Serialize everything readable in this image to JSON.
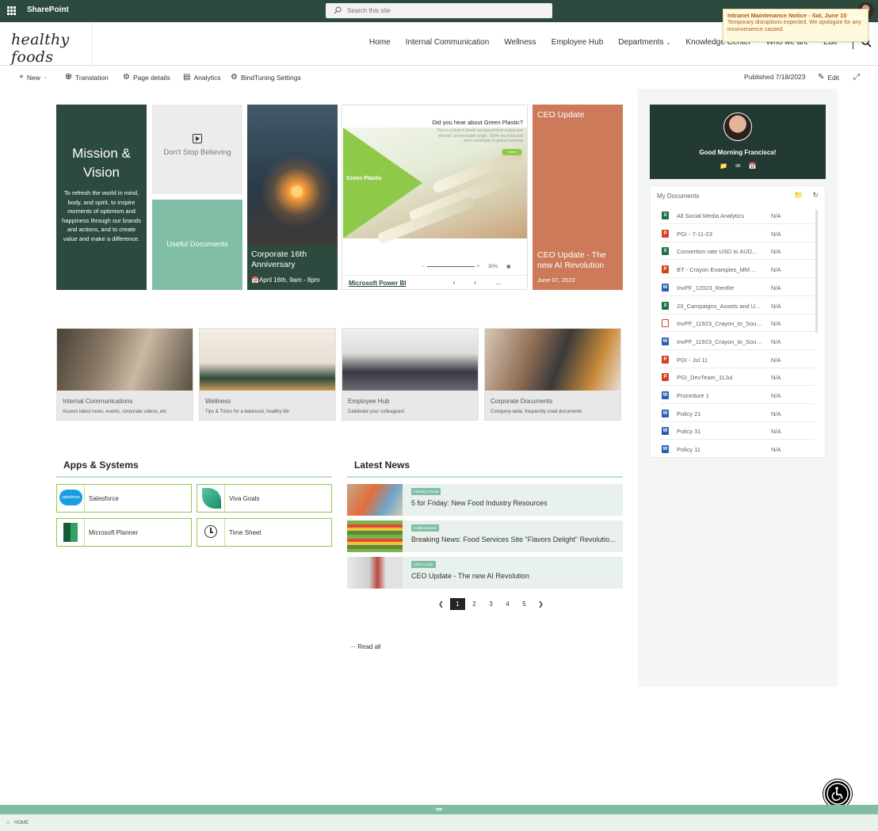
{
  "suite": {
    "app_name": "SharePoint",
    "search_placeholder": "Search this site"
  },
  "site": {
    "logo": "healthy foods",
    "nav": [
      {
        "label": "Home"
      },
      {
        "label": "Internal Communication"
      },
      {
        "label": "Wellness"
      },
      {
        "label": "Employee Hub"
      },
      {
        "label": "Departments",
        "has_menu": true
      },
      {
        "label": "Knowledge Center"
      },
      {
        "label": "Who we are"
      },
      {
        "label": "Edit"
      }
    ]
  },
  "notice": {
    "title": "Intranet Maintenance Notice - Sat, June 10",
    "body": "Temporary disruptions expected. We apologize for any inconvenience caused."
  },
  "commandbar": {
    "new": "New",
    "translation": "Translation",
    "page_details": "Page details",
    "analytics": "Analytics",
    "bindtuning": "BindTuning Settings",
    "published": "Published 7/18/2023",
    "edit": "Edit"
  },
  "hero": {
    "mission_title": "Mission & Vision",
    "mission_text": "To refresh the world in mind, body, and spirit, to inspire moments of optimism and happiness through our brands and actions, and to create value and make a difference.",
    "dont_stop": "Don't Stop Believing",
    "useful_docs": "Useful Documents",
    "anniversary_title": "Corporate 16th Anniversary",
    "anniversary_date": "April 16th, 9am - 8pm",
    "pbi_question": "Did you hear about Green Plastic?",
    "pbi_sub": "This is a kind of plastic produced from sugarcane ethanol, of renewable origin. 100% recycled and don't contribute to global warming",
    "pbi_green_label": "Green Plastic",
    "pbi_btn": "more",
    "pbi_zoom": "30%",
    "pbi_link": "Microsoft Power BI",
    "ceo_top": "CEO Update",
    "ceo_title": "CEO Update - The new AI Revolution",
    "ceo_date": "June 07, 2023"
  },
  "cards": [
    {
      "title": "Internal Communications",
      "desc": "Access latest news, events, corporate videos, etc"
    },
    {
      "title": "Wellness",
      "desc": "Tips & Tricks for a balanced, healthy life"
    },
    {
      "title": "Employee Hub",
      "desc": "Celebrate your colleagues!"
    },
    {
      "title": "Corporate Documents",
      "desc": "Company-wide, frequently used documents"
    }
  ],
  "apps": {
    "title": "Apps & Systems",
    "items": [
      {
        "label": "Salesforce",
        "icon_text": "salesforce"
      },
      {
        "label": "Viva Goals"
      },
      {
        "label": "Microsoft Planner"
      },
      {
        "label": "Time Sheet"
      }
    ]
  },
  "news": {
    "title": "Latest News",
    "items": [
      {
        "tag": "Industry Trends",
        "title": "5 for Friday: New Food Industry Resources"
      },
      {
        "tag": "Collaborations",
        "title": "Breaking News: Food Services Site \"Flavors Delight\" Revolutio..."
      },
      {
        "tag": "CEO Corner",
        "title": "CEO Update - The new AI Revolution"
      }
    ],
    "pages": [
      "1",
      "2",
      "3",
      "4",
      "5"
    ],
    "read_all": "Read all"
  },
  "profile": {
    "greeting": "Good Morning Francisca!"
  },
  "documents": {
    "title": "My Documents",
    "items": [
      {
        "type": "xlsx",
        "name": "All Social Media Analytics",
        "size": "N/A"
      },
      {
        "type": "pptx",
        "name": "PGI - 7-11-23",
        "size": "N/A"
      },
      {
        "type": "xlsx",
        "name": "Convertion rate USD to AUD...",
        "size": "N/A"
      },
      {
        "type": "pptx",
        "name": "BT - Crayon Examples_MM ...",
        "size": "N/A"
      },
      {
        "type": "docx",
        "name": "InvPF_12023_RenRe",
        "size": "N/A"
      },
      {
        "type": "xlsx",
        "name": "23_Campaigns_Assets and U...",
        "size": "N/A"
      },
      {
        "type": "pdf",
        "name": "InvPF_11923_Crayon_to_Soud...",
        "size": "N/A"
      },
      {
        "type": "docx",
        "name": "InvPF_11923_Crayon_to_Soud...",
        "size": "N/A"
      },
      {
        "type": "pptx",
        "name": "PGI - Jul 11",
        "size": "N/A"
      },
      {
        "type": "pptx",
        "name": "PGI_DevTeam_11Jul",
        "size": "N/A"
      },
      {
        "type": "docx",
        "name": "Procedure 1",
        "size": "N/A"
      },
      {
        "type": "docx",
        "name": "Policy 21",
        "size": "N/A"
      },
      {
        "type": "docx",
        "name": "Policy 31",
        "size": "N/A"
      },
      {
        "type": "docx",
        "name": "Policy 11",
        "size": "N/A"
      }
    ]
  },
  "breadcrumb": {
    "label": "HOME"
  },
  "colors": {
    "brand": "#2d4a3e",
    "accent": "#7fbea5",
    "ceo_tile": "#cd7a5a",
    "app_border": "#8fc94a"
  }
}
